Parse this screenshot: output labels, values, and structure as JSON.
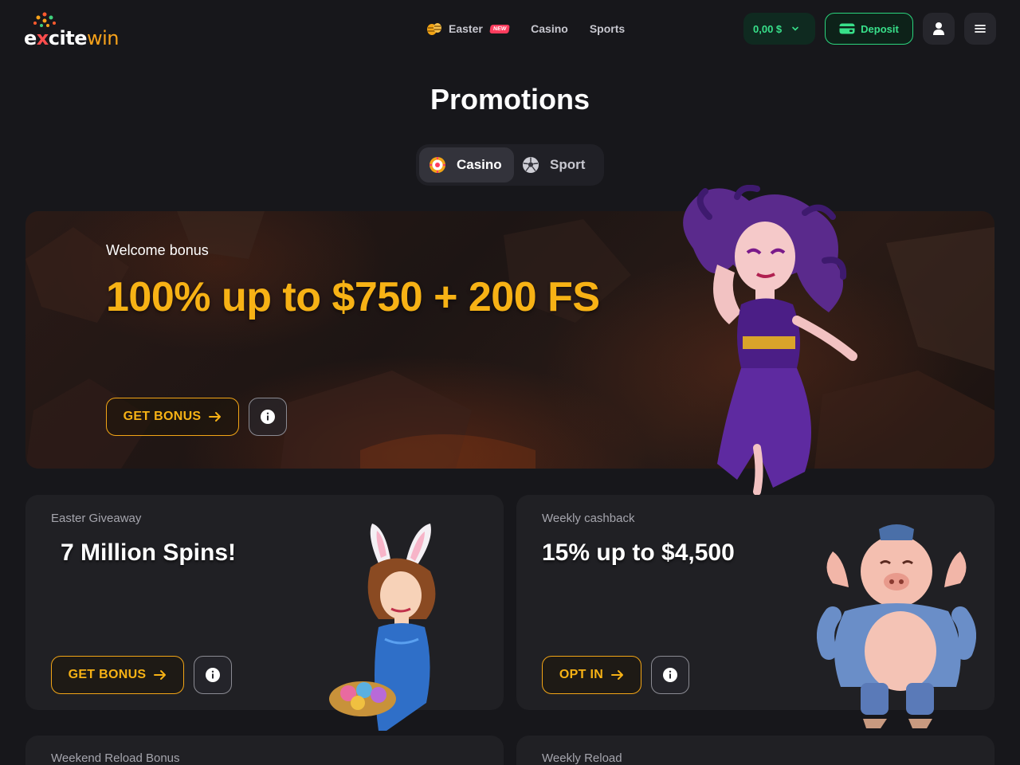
{
  "brand": {
    "logo_pre": "e",
    "logo_x": "x",
    "logo_mid": "cite",
    "logo_win": "win"
  },
  "nav": {
    "items": [
      {
        "label": "Easter",
        "badge": "NEW"
      },
      {
        "label": "Casino"
      },
      {
        "label": "Sports"
      }
    ]
  },
  "account": {
    "balance": "0,00 $",
    "deposit_label": "Deposit"
  },
  "page": {
    "title": "Promotions"
  },
  "tabs": [
    {
      "label": "Casino",
      "icon": "casino-chip-icon",
      "active": true
    },
    {
      "label": "Sport",
      "icon": "soccer-ball-icon",
      "active": false
    }
  ],
  "hero": {
    "label": "Welcome bonus",
    "title": "100% up to $750 + 200 FS",
    "cta": "GET BONUS",
    "image": "medusa-character"
  },
  "promos": [
    {
      "label": "Easter Giveaway",
      "title": "7 Million Spins!",
      "cta": "GET BONUS",
      "image": "bunny-girl-character"
    },
    {
      "label": "Weekly cashback",
      "title": "15% up to $4,500",
      "cta": "OPT IN",
      "image": "pig-character"
    },
    {
      "label": "Weekend Reload Bonus"
    },
    {
      "label": "Weekly Reload"
    }
  ],
  "colors": {
    "background": "#17171b",
    "card": "#202024",
    "accent": "#f7b215",
    "green": "#38e08a",
    "badge": "#ff3d5e"
  }
}
